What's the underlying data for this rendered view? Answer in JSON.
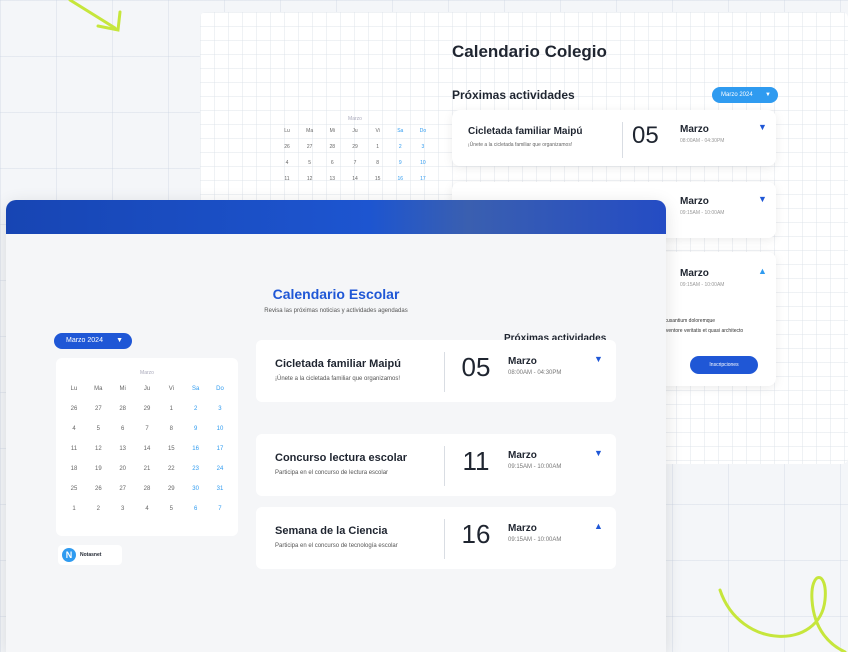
{
  "back": {
    "title": "Calendario Colegio",
    "subtitle": "Próximas actividades",
    "dropdown": "Marzo 2024",
    "mini_title": "Marzo",
    "weekdays": [
      "Lu",
      "Ma",
      "Mi",
      "Ju",
      "Vi",
      "Sa",
      "Do"
    ],
    "rows": [
      [
        "26",
        "27",
        "28",
        "29",
        "1",
        "2",
        "3"
      ],
      [
        "4",
        "5",
        "6",
        "7",
        "8",
        "9",
        "10"
      ],
      [
        "11",
        "12",
        "13",
        "14",
        "15",
        "16",
        "17"
      ]
    ],
    "events": [
      {
        "title": "Cicletada familiar Maipú",
        "desc": "¡Únete a la cicletada familiar que organizamos!",
        "day": "05",
        "month": "Marzo",
        "time": "08:00AM - 04:30PM"
      },
      {
        "title": "",
        "desc": "",
        "day": "",
        "month": "Marzo",
        "time": "09:15AM - 10:00AM"
      }
    ],
    "expanded": {
      "month": "Marzo",
      "time": "09:15AM - 10:00AM",
      "desc1": "ccusantium doloremque",
      "desc2": "inventore veritatis et quasi architecto",
      "button": "Inscripciones"
    }
  },
  "front": {
    "title": "Calendario Escolar",
    "subtitle": "Revisa las próximas noticias y actividades agendadas",
    "dropdown": "Marzo 2024",
    "next_title": "Próximas actividades",
    "mini_title": "Marzo",
    "weekdays": [
      "Lu",
      "Ma",
      "Mi",
      "Ju",
      "Vi",
      "Sa",
      "Do"
    ],
    "rows": [
      [
        "26",
        "27",
        "28",
        "29",
        "1",
        "2",
        "3"
      ],
      [
        "4",
        "5",
        "6",
        "7",
        "8",
        "9",
        "10"
      ],
      [
        "11",
        "12",
        "13",
        "14",
        "15",
        "16",
        "17"
      ],
      [
        "18",
        "19",
        "20",
        "21",
        "22",
        "23",
        "24"
      ],
      [
        "25",
        "26",
        "27",
        "28",
        "29",
        "30",
        "31"
      ],
      [
        "1",
        "2",
        "3",
        "4",
        "5",
        "6",
        "7"
      ]
    ],
    "logo_letter": "N",
    "logo_text": "Notasnet",
    "events": [
      {
        "title": "Cicletada familiar Maipú",
        "desc": "¡Únete a la cicletada familiar que organizamos!",
        "day": "05",
        "month": "Marzo",
        "time": "08:00AM - 04:30PM",
        "arrow": "▼"
      },
      {
        "title": "Concurso lectura escolar",
        "desc": "Participa en el concurso de lectura escolar",
        "day": "11",
        "month": "Marzo",
        "time": "09:15AM - 10:00AM",
        "arrow": "▼"
      },
      {
        "title": "Semana de la Ciencia",
        "desc": "Participa en el concurso de tecnología escolar",
        "day": "16",
        "month": "Marzo",
        "time": "09:15AM - 10:00AM",
        "arrow": "▲"
      }
    ]
  },
  "colors": {
    "accent": "#1f57d6",
    "light_accent": "#2f9bf0",
    "lime": "#c6e63c"
  }
}
